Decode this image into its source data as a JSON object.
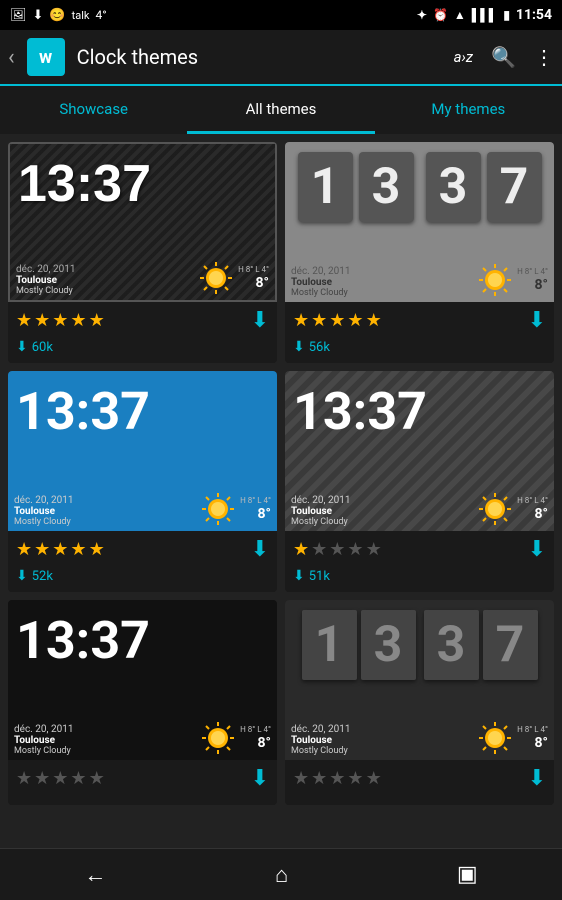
{
  "statusBar": {
    "time": "11:54",
    "icons": [
      "bluetooth",
      "clock",
      "wifi",
      "signal",
      "battery"
    ]
  },
  "appBar": {
    "backLabel": "‹",
    "logoText": "w",
    "title": "Clock themes",
    "sortLabel": "a›z",
    "searchLabel": "🔍",
    "menuLabel": "⋮"
  },
  "tabs": [
    {
      "id": "showcase",
      "label": "Showcase"
    },
    {
      "id": "all",
      "label": "All themes",
      "active": true
    },
    {
      "id": "my",
      "label": "My themes"
    }
  ],
  "themes": [
    {
      "id": 1,
      "style": "dark-diagonal",
      "time": "13:37",
      "date": "déc. 20, 2011",
      "city": "Toulouse",
      "desc": "Mostly Cloudy",
      "temp": "8°",
      "stars": 5,
      "downloads": "60k"
    },
    {
      "id": 2,
      "style": "flip-gray",
      "time": "1337",
      "date": "déc. 20, 2011",
      "city": "Toulouse",
      "desc": "Mostly Cloudy",
      "temp": "8°",
      "stars": 5,
      "downloads": "56k"
    },
    {
      "id": 3,
      "style": "blue-bg",
      "time": "13:37",
      "date": "déc. 20, 2011",
      "city": "Toulouse",
      "desc": "Mostly Cloudy",
      "temp": "8°",
      "stars": 5,
      "downloads": "52k"
    },
    {
      "id": 4,
      "style": "dark-stripe",
      "time": "13:37",
      "date": "déc. 20, 2011",
      "city": "Toulouse",
      "desc": "Mostly Cloudy",
      "temp": "8°",
      "stars": 1,
      "downloads": "51k"
    },
    {
      "id": 5,
      "style": "pure-black",
      "time": "13:37",
      "date": "déc. 20, 2011",
      "city": "Toulouse",
      "desc": "Mostly Cloudy",
      "temp": "8°",
      "stars": 0,
      "downloads": ""
    },
    {
      "id": 6,
      "style": "flip-dark",
      "time": "1337",
      "date": "déc. 20, 2011",
      "city": "Toulouse",
      "desc": "Mostly Cloudy",
      "temp": "8°",
      "stars": 0,
      "downloads": ""
    }
  ],
  "bottomNav": {
    "backLabel": "←",
    "homeLabel": "⌂",
    "recentLabel": "▣"
  }
}
